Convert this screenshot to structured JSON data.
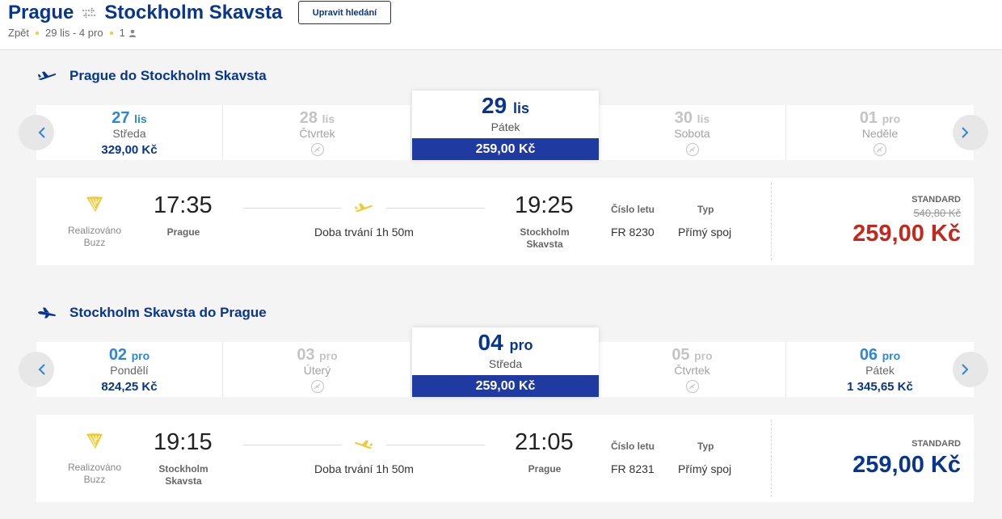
{
  "header": {
    "origin": "Prague",
    "destination": "Stockholm Skavsta",
    "edit_button": "Upravit hledání",
    "back": "Zpět",
    "dates": "29 lis - 4 pro",
    "passengers": "1"
  },
  "outbound": {
    "title": "Prague do Stockholm Skavsta",
    "dates": [
      {
        "day": "27",
        "month": "lis",
        "weekday": "Středa",
        "price": "329,00 Kč"
      },
      {
        "day": "28",
        "month": "lis",
        "weekday": "Čtvrtek",
        "price": ""
      },
      {
        "day": "29",
        "month": "lis",
        "weekday": "Pátek",
        "price": "259,00 Kč"
      },
      {
        "day": "30",
        "month": "lis",
        "weekday": "Sobota",
        "price": ""
      },
      {
        "day": "01",
        "month": "pro",
        "weekday": "Neděle",
        "price": ""
      }
    ],
    "flight": {
      "operated_line1": "Realizováno",
      "operated_line2": "Buzz",
      "dep_time": "17:35",
      "dep_city": "Prague",
      "duration": "Doba trvání 1h 50m",
      "arr_time": "19:25",
      "arr_city_line1": "Stockholm",
      "arr_city_line2": "Skavsta",
      "flight_no_label": "Číslo letu",
      "flight_no": "FR 8230",
      "type_label": "Typ",
      "type": "Přímý spoj",
      "fare_label": "STANDARD",
      "old_price": "540,80 Kč",
      "price": "259,00 Kč"
    }
  },
  "inbound": {
    "title": "Stockholm Skavsta do Prague",
    "dates": [
      {
        "day": "02",
        "month": "pro",
        "weekday": "Pondělí",
        "price": "824,25 Kč"
      },
      {
        "day": "03",
        "month": "pro",
        "weekday": "Úterý",
        "price": ""
      },
      {
        "day": "04",
        "month": "pro",
        "weekday": "Středa",
        "price": "259,00 Kč"
      },
      {
        "day": "05",
        "month": "pro",
        "weekday": "Čtvrtek",
        "price": ""
      },
      {
        "day": "06",
        "month": "pro",
        "weekday": "Pátek",
        "price": "1 345,65 Kč"
      }
    ],
    "flight": {
      "operated_line1": "Realizováno",
      "operated_line2": "Buzz",
      "dep_time": "19:15",
      "dep_city_line1": "Stockholm",
      "dep_city_line2": "Skavsta",
      "duration": "Doba trvání 1h 50m",
      "arr_time": "21:05",
      "arr_city": "Prague",
      "flight_no_label": "Číslo letu",
      "flight_no": "FR 8231",
      "type_label": "Typ",
      "type": "Přímý spoj",
      "fare_label": "STANDARD",
      "price": "259,00 Kč"
    }
  },
  "colors": {
    "brand_blue": "#073590",
    "accent_yellow": "#f1c933",
    "sale_red": "#c4281c",
    "link_blue": "#2d86d8"
  },
  "icons": [
    "swap-arrows-icon",
    "person-icon",
    "plane-takeoff-icon",
    "plane-landing-icon",
    "chevron-left-icon",
    "chevron-right-icon",
    "no-flight-icon",
    "airline-harp-logo",
    "plane-icon"
  ]
}
